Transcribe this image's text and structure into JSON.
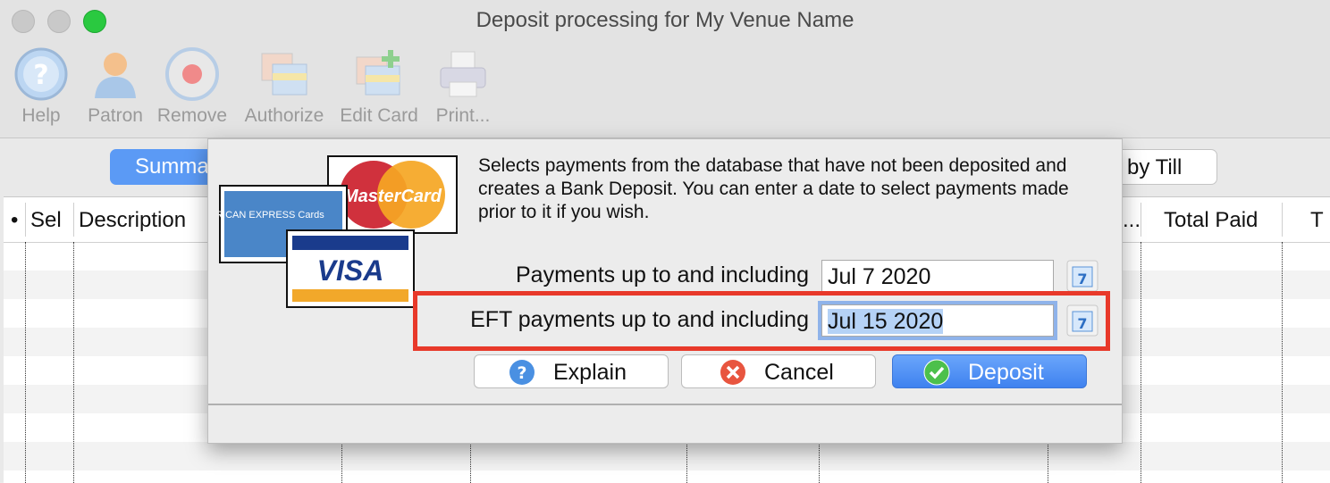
{
  "window": {
    "title": "Deposit processing for My Venue Name"
  },
  "toolbar": {
    "items": [
      {
        "label": "Help",
        "icon": "help-icon"
      },
      {
        "label": "Patron",
        "icon": "patron-icon"
      },
      {
        "label": "Remove",
        "icon": "remove-icon"
      },
      {
        "label": "Authorize",
        "icon": "authorize-icon"
      },
      {
        "label": "Edit Card",
        "icon": "edit-card-icon"
      },
      {
        "label": "Print...",
        "icon": "printer-icon"
      }
    ]
  },
  "tabs": {
    "left": "Summa",
    "right": "by Till"
  },
  "table": {
    "headers": [
      "•",
      "Sel",
      "Description",
      "...",
      "Total Paid",
      "T"
    ]
  },
  "dialog": {
    "description": "Selects payments from the database that have not been deposited and creates a Bank Deposit.  You can enter a date to select payments made prior to it if you wish.",
    "payments_label": "Payments up to and including",
    "payments_value": "Jul 7 2020",
    "eft_label": "EFT payments up to and including",
    "eft_value": "Jul 15 2020",
    "calendar_glyph": "7",
    "cards": {
      "amex": "AMERICAN EXPRESS Cards",
      "mastercard": "MasterCard",
      "visa": "VISA"
    },
    "buttons": {
      "explain": "Explain",
      "cancel": "Cancel",
      "deposit": "Deposit"
    }
  },
  "colors": {
    "highlight": "#e8392a",
    "primary": "#3f82ef",
    "selection": "#b5d2f6"
  }
}
